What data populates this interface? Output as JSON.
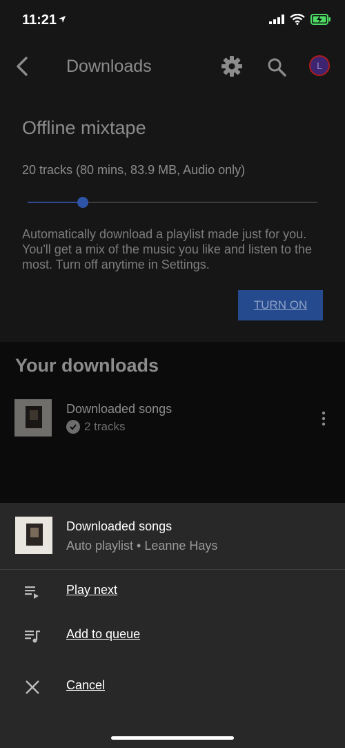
{
  "status_bar": {
    "time": "11:21",
    "icons": [
      "location-arrow-icon",
      "signal-icon",
      "wifi-icon",
      "battery-charging-icon"
    ]
  },
  "header": {
    "title": "Downloads",
    "avatar_initial": "L",
    "icons": [
      "back-icon",
      "gear-icon",
      "search-icon"
    ]
  },
  "mixtape": {
    "title": "Offline mixtape",
    "tracks_info": "20 tracks (80 mins, 83.9 MB, Audio only)",
    "slider_value_fraction": 0.19,
    "description": "Automatically download a playlist made just for you. You'll get a mix of the music you like and listen to the most. Turn off anytime in Settings.",
    "button_label": "TURN ON"
  },
  "downloads": {
    "heading": "Your downloads",
    "items": [
      {
        "title": "Downloaded songs",
        "subtitle": "2 tracks"
      }
    ]
  },
  "sheet": {
    "title": "Downloaded songs",
    "subtitle": "Auto playlist • Leanne Hays",
    "menu": [
      {
        "label": "Play next",
        "icon": "play-next-icon"
      },
      {
        "label": "Add to queue",
        "icon": "add-to-queue-icon"
      },
      {
        "label": "Cancel",
        "icon": "close-icon"
      }
    ]
  },
  "colors": {
    "accent": "#2e54a8",
    "background": "#0b0b0b",
    "sheet": "#282828",
    "avatar_ring": "#b01c1c"
  }
}
